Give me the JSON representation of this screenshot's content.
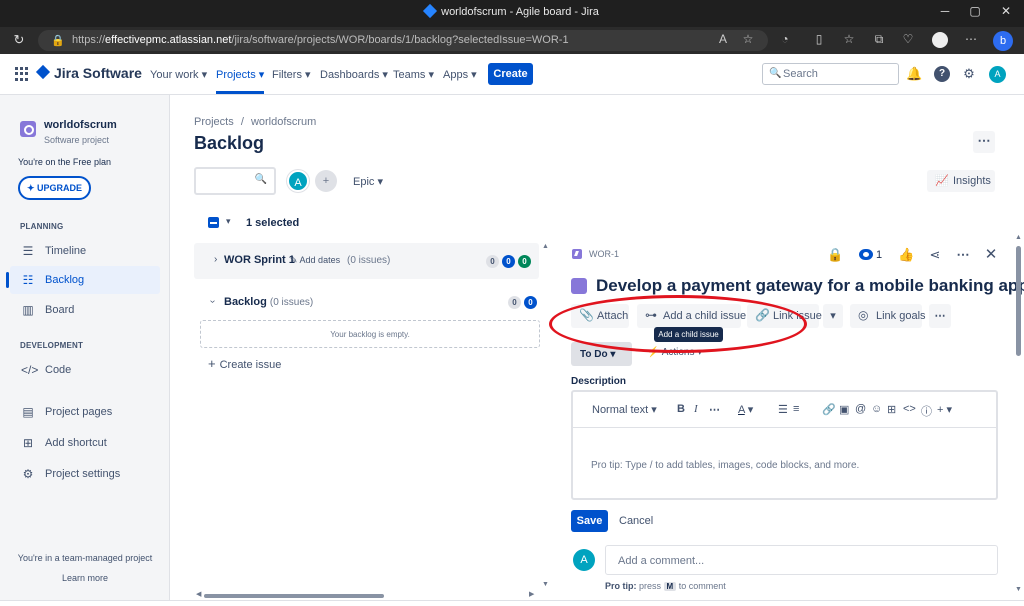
{
  "browser": {
    "window_title": "worldofscrum - Agile board - Jira",
    "url_prefix": "https://",
    "url_host": "effectivepmc.atlassian.net",
    "url_path": "/jira/software/projects/WOR/boards/1/backlog?selectedIssue=WOR-1"
  },
  "topnav": {
    "product": "Jira Software",
    "items": [
      {
        "label": "Your work"
      },
      {
        "label": "Projects"
      },
      {
        "label": "Filters"
      },
      {
        "label": "Dashboards"
      },
      {
        "label": "Teams"
      },
      {
        "label": "Apps"
      }
    ],
    "create_label": "Create",
    "search_placeholder": "Search",
    "avatar_initial": "A"
  },
  "sidebar": {
    "project_name": "worldofscrum",
    "project_type": "Software project",
    "plan_text": "You're on the Free plan",
    "upgrade_label": "UPGRADE",
    "planning_heading": "PLANNING",
    "development_heading": "DEVELOPMENT",
    "planning_items": [
      {
        "label": "Timeline"
      },
      {
        "label": "Backlog"
      },
      {
        "label": "Board"
      }
    ],
    "development_items": [
      {
        "label": "Code"
      }
    ],
    "other_items": [
      {
        "label": "Project pages"
      },
      {
        "label": "Add shortcut"
      },
      {
        "label": "Project settings"
      }
    ],
    "footer_text": "You're in a team-managed project",
    "learn_more": "Learn more"
  },
  "backlog": {
    "breadcrumb_projects": "Projects",
    "breadcrumb_sep": "/",
    "breadcrumb_project": "worldofscrum",
    "title": "Backlog",
    "avatar_initial": "A",
    "epic_filter": "Epic",
    "insights_label": "Insights",
    "selected_count": "1 selected",
    "sprint": {
      "name": "WOR Sprint 1",
      "add_dates": "Add dates",
      "issue_count": "(0 issues)",
      "counts": [
        "0",
        "0",
        "0"
      ]
    },
    "backlog_section": {
      "name": "Backlog",
      "issue_count": "(0 issues)",
      "counts": [
        "0",
        "0"
      ],
      "empty_text": "Your backlog is empty."
    },
    "create_issue": "Create issue"
  },
  "detail": {
    "issue_key": "WOR-1",
    "watch_count": "1",
    "title": "Develop a payment gateway for a mobile banking app",
    "actions": {
      "attach": "Attach",
      "add_child": "Add a child issue",
      "link_issue": "Link issue",
      "link_goals": "Link goals"
    },
    "tooltip": "Add a child issue",
    "status": "To Do",
    "actions_menu": "Actions",
    "description_label": "Description",
    "editor": {
      "text_style": "Normal text",
      "placeholder": "Pro tip: Type / to add tables, images, code blocks, and more."
    },
    "save_label": "Save",
    "cancel_label": "Cancel",
    "comment_avatar": "A",
    "comment_placeholder": "Add a comment...",
    "protip_prefix": "Pro tip:",
    "protip_press": "press",
    "protip_key": "M",
    "protip_suffix": "to comment"
  }
}
